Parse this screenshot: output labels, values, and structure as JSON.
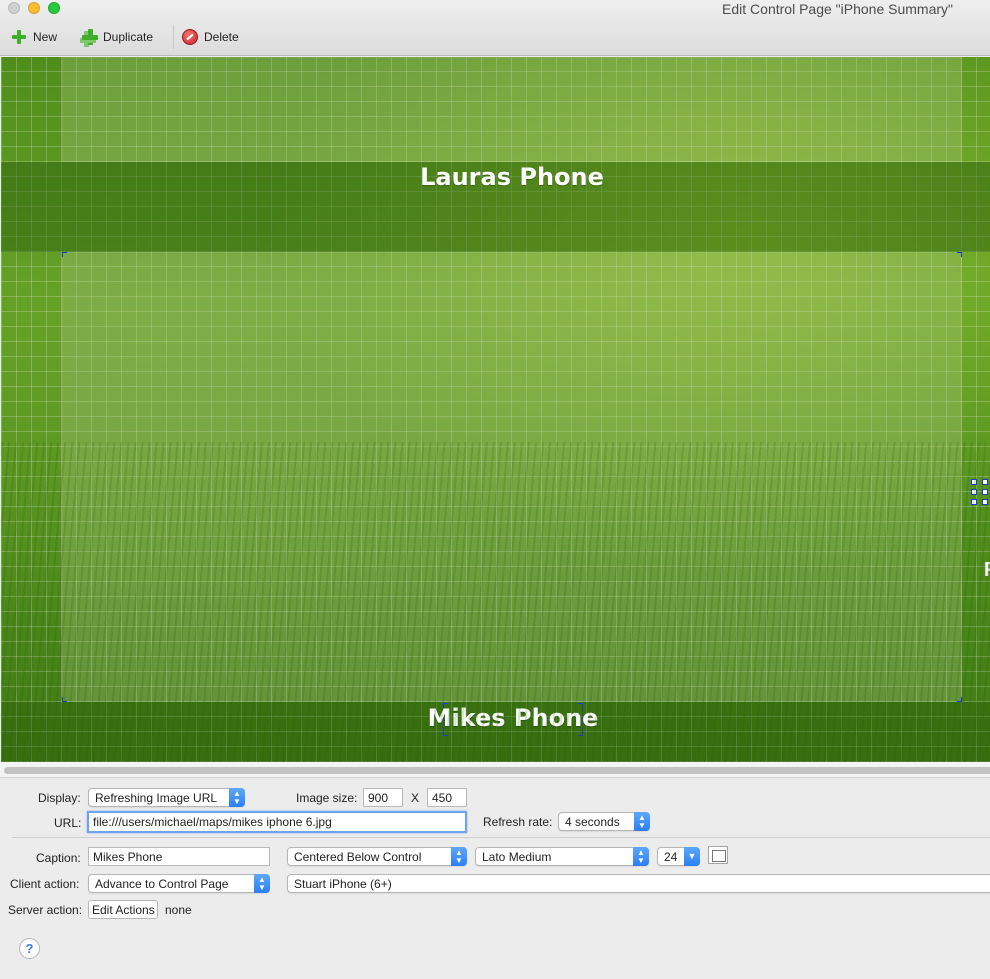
{
  "window": {
    "title": "Edit Control Page \"iPhone Summary\""
  },
  "toolbar": {
    "new_label": "New",
    "duplicate_label": "Duplicate",
    "delete_label": "Delete"
  },
  "canvas": {
    "top_caption": "Lauras Phone",
    "bottom_caption": "Mikes Phone",
    "side_letter": "F"
  },
  "inspector": {
    "display_label": "Display:",
    "display_value": "Refreshing Image URL",
    "image_size_label": "Image size:",
    "image_width": "900",
    "size_separator": "X",
    "image_height": "450",
    "url_label": "URL:",
    "url_value": "file:///users/michael/maps/mikes iphone 6.jpg",
    "refresh_label": "Refresh rate:",
    "refresh_value": "4 seconds",
    "caption_label": "Caption:",
    "caption_value": "Mikes Phone",
    "caption_position": "Centered Below Control",
    "font_value": "Lato Medium",
    "font_size": "24",
    "client_action_label": "Client action:",
    "client_action_value": "Advance to Control Page",
    "client_action_target": "Stuart iPhone (6+)",
    "server_action_label": "Server action:",
    "edit_actions_label": "Edit Actions",
    "server_action_value": "none",
    "help_label": "?"
  }
}
